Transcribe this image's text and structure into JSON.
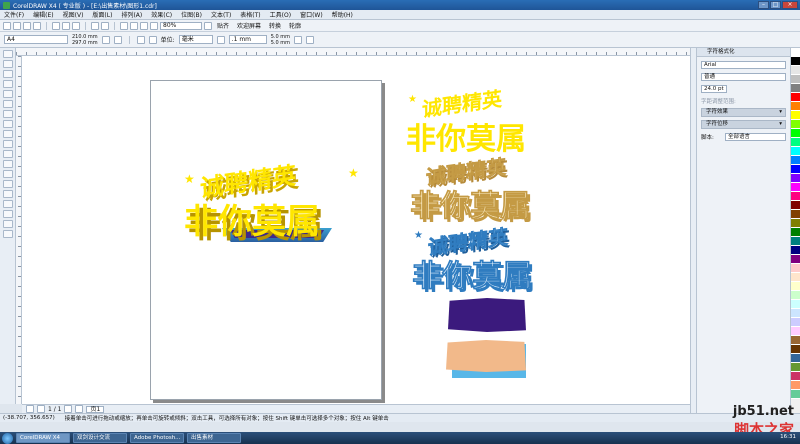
{
  "window": {
    "title": "CorelDRAW X4 ( 专业版 ) - [E:\\出售素材\\图形1.cdr]",
    "minimize": "–",
    "maximize": "□",
    "close": "×"
  },
  "menu": [
    "文件(F)",
    "编辑(E)",
    "视图(V)",
    "版面(L)",
    "排列(A)",
    "效果(C)",
    "位图(B)",
    "文本(T)",
    "表格(T)",
    "工具(O)",
    "窗口(W)",
    "帮助(H)"
  ],
  "toolbar": {
    "zoom": "80%",
    "snap_label": "贴齐",
    "welcome_label": "欢迎屏幕",
    "convert_label": "转换",
    "outline_label": "轮廓"
  },
  "property_bar": {
    "page_size": "A4",
    "width": "210.0 mm",
    "height": "297.0 mm",
    "units_label": "单位:",
    "units_value": "毫米",
    "nudge": ".1 mm",
    "dup_x": "5.0 mm",
    "dup_y": "5.0 mm"
  },
  "docker": {
    "title": "字符格式化",
    "font": "Arial",
    "style": "普通",
    "size": "24.0 pt",
    "spacing_label": "字距调整范围:",
    "section_effects": "字符效果",
    "section_shift": "字符位移",
    "script_label": "脚本:",
    "script_value": "全部语言"
  },
  "artwork": {
    "line1": "诚聘精英",
    "line2": "非你莫属"
  },
  "navigator": {
    "page_count": "1 / 1",
    "page_tab": "页1"
  },
  "status": {
    "coords": "(-38.707, 356.657)",
    "hint": "接着单击可进行拖动或缩放；再单击可旋转或倾斜；双击工具，可选择所有对象；按住 Shift 键单击可选择多个对象；按住 Alt 键单击"
  },
  "taskbar": {
    "items": [
      "CorelDRAW X4",
      "双剑设计交流",
      "Adobe Photosh...",
      "出售素材"
    ],
    "tray": "16:31"
  },
  "watermark": {
    "site": "jb51.net",
    "name": "脚本之家"
  },
  "palette_colors": [
    "#ffffff",
    "#000000",
    "#e6e6e6",
    "#c0c0c0",
    "#808080",
    "#ff0000",
    "#ff8000",
    "#ffff00",
    "#80ff00",
    "#00ff00",
    "#00ff80",
    "#00ffff",
    "#0080ff",
    "#0000ff",
    "#8000ff",
    "#ff00ff",
    "#ff0080",
    "#800000",
    "#804000",
    "#808000",
    "#008000",
    "#008080",
    "#000080",
    "#800080",
    "#ffcccc",
    "#ffe5cc",
    "#ffffcc",
    "#ccffcc",
    "#ccffff",
    "#cce5ff",
    "#ccccff",
    "#ffccff",
    "#996633",
    "#663300",
    "#336699",
    "#669933",
    "#cc3366",
    "#ff9966",
    "#66cc99"
  ]
}
